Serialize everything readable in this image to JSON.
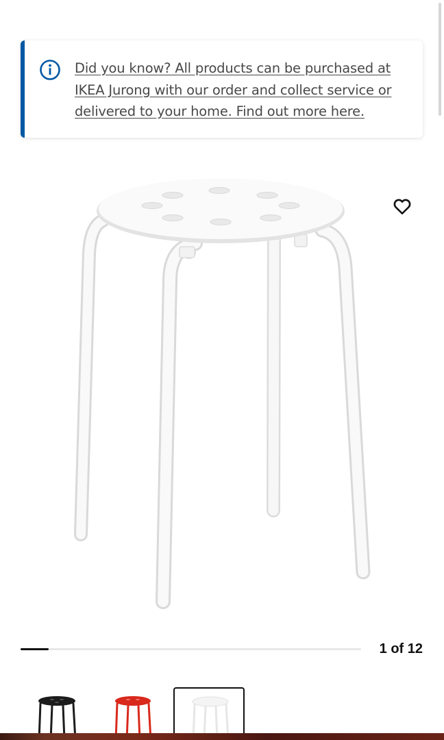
{
  "notice": {
    "text": "Did you know? All products can be purchased at IKEA Jurong with our order and collect service or delivered to your home. Find out more here.",
    "icon": "info-icon",
    "accent_color": "#0058a3"
  },
  "gallery": {
    "counter_label": "1 of 12",
    "current_index": 1,
    "total_images": 12,
    "favourite_icon": "heart-outline-icon",
    "thumbnails": [
      {
        "color": "black",
        "selected": false
      },
      {
        "color": "red",
        "selected": false
      },
      {
        "color": "white",
        "selected": true
      }
    ]
  }
}
